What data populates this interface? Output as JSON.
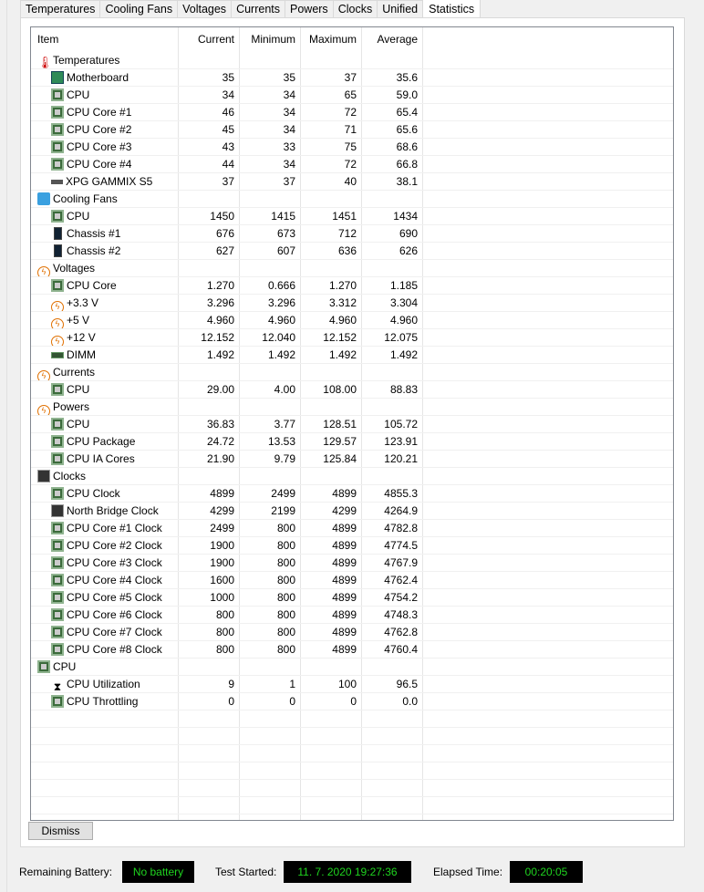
{
  "tabs": [
    "Temperatures",
    "Cooling Fans",
    "Voltages",
    "Currents",
    "Powers",
    "Clocks",
    "Unified",
    "Statistics"
  ],
  "active_tab": "Statistics",
  "columns": [
    "Item",
    "Current",
    "Minimum",
    "Maximum",
    "Average"
  ],
  "rows": [
    {
      "group": true,
      "icon": "thermometer-icon",
      "label": "Temperatures"
    },
    {
      "icon": "motherboard-icon",
      "label": "Motherboard",
      "v": [
        "35",
        "35",
        "37",
        "35.6"
      ]
    },
    {
      "icon": "cpu-chip-icon",
      "label": "CPU",
      "v": [
        "34",
        "34",
        "65",
        "59.0"
      ]
    },
    {
      "icon": "cpu-chip-icon",
      "label": "CPU Core #1",
      "v": [
        "46",
        "34",
        "72",
        "65.4"
      ]
    },
    {
      "icon": "cpu-chip-icon",
      "label": "CPU Core #2",
      "v": [
        "45",
        "34",
        "71",
        "65.6"
      ]
    },
    {
      "icon": "cpu-chip-icon",
      "label": "CPU Core #3",
      "v": [
        "43",
        "33",
        "75",
        "68.6"
      ]
    },
    {
      "icon": "cpu-chip-icon",
      "label": "CPU Core #4",
      "v": [
        "44",
        "34",
        "72",
        "66.8"
      ]
    },
    {
      "icon": "ssd-icon",
      "label": "XPG GAMMIX S5",
      "v": [
        "37",
        "37",
        "40",
        "38.1"
      ]
    },
    {
      "group": true,
      "icon": "fan-icon",
      "label": "Cooling Fans"
    },
    {
      "icon": "cpu-chip-icon",
      "label": "CPU",
      "v": [
        "1450",
        "1415",
        "1451",
        "1434"
      ]
    },
    {
      "icon": "chassis-icon",
      "label": "Chassis #1",
      "v": [
        "676",
        "673",
        "712",
        "690"
      ]
    },
    {
      "icon": "chassis-icon",
      "label": "Chassis #2",
      "v": [
        "627",
        "607",
        "636",
        "626"
      ]
    },
    {
      "group": true,
      "icon": "voltage-icon",
      "label": "Voltages"
    },
    {
      "icon": "cpu-chip-icon",
      "label": "CPU Core",
      "v": [
        "1.270",
        "0.666",
        "1.270",
        "1.185"
      ]
    },
    {
      "icon": "voltage-icon",
      "label": "+3.3 V",
      "v": [
        "3.296",
        "3.296",
        "3.312",
        "3.304"
      ]
    },
    {
      "icon": "voltage-icon",
      "label": "+5 V",
      "v": [
        "4.960",
        "4.960",
        "4.960",
        "4.960"
      ]
    },
    {
      "icon": "voltage-icon",
      "label": "+12 V",
      "v": [
        "12.152",
        "12.040",
        "12.152",
        "12.075"
      ]
    },
    {
      "icon": "memory-icon",
      "label": "DIMM",
      "v": [
        "1.492",
        "1.492",
        "1.492",
        "1.492"
      ]
    },
    {
      "group": true,
      "icon": "voltage-icon",
      "label": "Currents"
    },
    {
      "icon": "cpu-chip-icon",
      "label": "CPU",
      "v": [
        "29.00",
        "4.00",
        "108.00",
        "88.83"
      ]
    },
    {
      "group": true,
      "icon": "voltage-icon",
      "label": "Powers"
    },
    {
      "icon": "cpu-chip-icon",
      "label": "CPU",
      "v": [
        "36.83",
        "3.77",
        "128.51",
        "105.72"
      ]
    },
    {
      "icon": "cpu-chip-icon",
      "label": "CPU Package",
      "v": [
        "24.72",
        "13.53",
        "129.57",
        "123.91"
      ]
    },
    {
      "icon": "cpu-chip-icon",
      "label": "CPU IA Cores",
      "v": [
        "21.90",
        "9.79",
        "125.84",
        "120.21"
      ]
    },
    {
      "group": true,
      "icon": "clock-chip-icon",
      "label": "Clocks"
    },
    {
      "icon": "cpu-chip-icon",
      "label": "CPU Clock",
      "v": [
        "4899",
        "2499",
        "4899",
        "4855.3"
      ]
    },
    {
      "icon": "clock-chip-icon",
      "label": "North Bridge Clock",
      "v": [
        "4299",
        "2199",
        "4299",
        "4264.9"
      ]
    },
    {
      "icon": "cpu-chip-icon",
      "label": "CPU Core #1 Clock",
      "v": [
        "2499",
        "800",
        "4899",
        "4782.8"
      ]
    },
    {
      "icon": "cpu-chip-icon",
      "label": "CPU Core #2 Clock",
      "v": [
        "1900",
        "800",
        "4899",
        "4774.5"
      ]
    },
    {
      "icon": "cpu-chip-icon",
      "label": "CPU Core #3 Clock",
      "v": [
        "1900",
        "800",
        "4899",
        "4767.9"
      ]
    },
    {
      "icon": "cpu-chip-icon",
      "label": "CPU Core #4 Clock",
      "v": [
        "1600",
        "800",
        "4899",
        "4762.4"
      ]
    },
    {
      "icon": "cpu-chip-icon",
      "label": "CPU Core #5 Clock",
      "v": [
        "1000",
        "800",
        "4899",
        "4754.2"
      ]
    },
    {
      "icon": "cpu-chip-icon",
      "label": "CPU Core #6 Clock",
      "v": [
        "800",
        "800",
        "4899",
        "4748.3"
      ]
    },
    {
      "icon": "cpu-chip-icon",
      "label": "CPU Core #7 Clock",
      "v": [
        "800",
        "800",
        "4899",
        "4762.8"
      ]
    },
    {
      "icon": "cpu-chip-icon",
      "label": "CPU Core #8 Clock",
      "v": [
        "800",
        "800",
        "4899",
        "4760.4"
      ]
    },
    {
      "group": true,
      "icon": "cpu-chip-icon",
      "label": "CPU"
    },
    {
      "icon": "hourglass-icon",
      "label": "CPU Utilization",
      "v": [
        "9",
        "1",
        "100",
        "96.5"
      ]
    },
    {
      "icon": "cpu-chip-icon",
      "label": "CPU Throttling",
      "v": [
        "0",
        "0",
        "0",
        "0.0"
      ]
    }
  ],
  "dismiss_label": "Dismiss",
  "status": {
    "battery_label": "Remaining Battery:",
    "battery_value": "No battery",
    "started_label": "Test Started:",
    "started_value": "11. 7. 2020 19:27:36",
    "elapsed_label": "Elapsed Time:",
    "elapsed_value": "00:20:05"
  }
}
